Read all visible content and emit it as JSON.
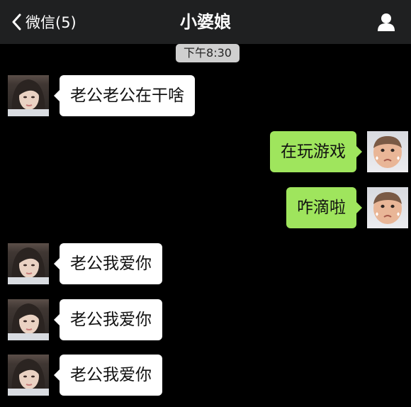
{
  "nav": {
    "back_label": "微信(5)",
    "title": "小婆娘",
    "profile_icon": "person-icon"
  },
  "chat": {
    "timestamp": "下午8:30",
    "messages": [
      {
        "sender": "contact",
        "text": "老公老公在干啥"
      },
      {
        "sender": "me",
        "text": "在玩游戏"
      },
      {
        "sender": "me",
        "text": "咋滴啦"
      },
      {
        "sender": "contact",
        "text": "老公我爱你"
      },
      {
        "sender": "contact",
        "text": "老公我爱你"
      },
      {
        "sender": "contact",
        "text": "老公我爱你"
      }
    ]
  },
  "colors": {
    "background": "#000000",
    "navbar": "#1f2021",
    "incoming_bubble": "#ffffff",
    "outgoing_bubble": "#9fe55d",
    "timestamp_bg": "#cfcfcf"
  }
}
